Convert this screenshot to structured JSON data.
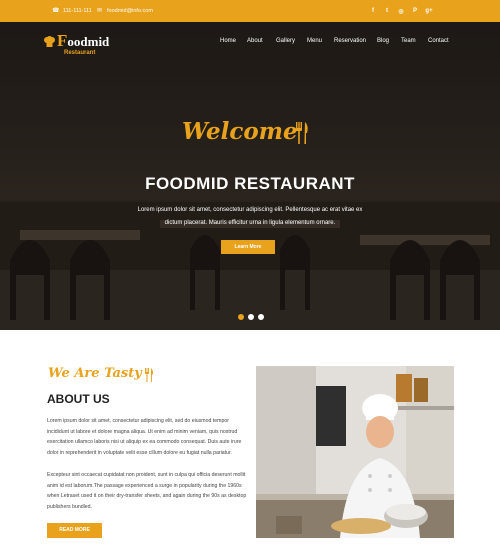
{
  "topbar": {
    "phone": "111-111-111",
    "email": "foodmid@info.com",
    "social_icons": [
      "facebook-icon",
      "twitter-icon",
      "instagram-icon",
      "pinterest-icon",
      "google-plus-icon"
    ],
    "social_glyphs": [
      "f",
      "t",
      "◎",
      "P",
      "g+"
    ]
  },
  "brand": {
    "name": "oodmid",
    "initial": "F",
    "subtitle": "Restaurant"
  },
  "nav": [
    "Home",
    "About",
    "Gallery",
    "Menu",
    "Reservation",
    "Blog",
    "Team",
    "Contact"
  ],
  "hero": {
    "welcome": "Welcome",
    "title": "FOODMID RESTAURANT",
    "lead_1": "Lorem ipsum dolor sit amet, consectetur adipiscing elit. Pellentesque ac erat vitae ex",
    "lead_2": "dictum placerat. Mauris efficitur urna in ligula elementum ornare.",
    "button": "Learn More",
    "slides": 3,
    "active_slide": 1
  },
  "about": {
    "tagline": "We Are Tasty",
    "title": "ABOUT US",
    "p1": "Lorem ipsum dolor sit amet, consectetur adipiscing elit, sed do eiusmod tempor incididunt ut labore et dolore magna aliqua. Ut enim ad minim veniam, quis nostrud exercitation ullamco laboris nisi ut aliquip ex ea commodo consequat. Duis aute irure dolor in reprehenderit in voluptate velit esse cillum dolore eu fugiat nulla pariatur.",
    "p2": "Excepteur sint occaecat cupidatat non proident, sunt in culpa qui officia deserunt mollit anim id est laborum.The passage experienced a surge in popularity during the 1960s when Letraset used it on their dry-transfer sheets, and again during the 90s as desktop publishers bundled.",
    "button": "READ MORE"
  },
  "colors": {
    "accent": "#e9a21c",
    "dark": "#222222"
  }
}
